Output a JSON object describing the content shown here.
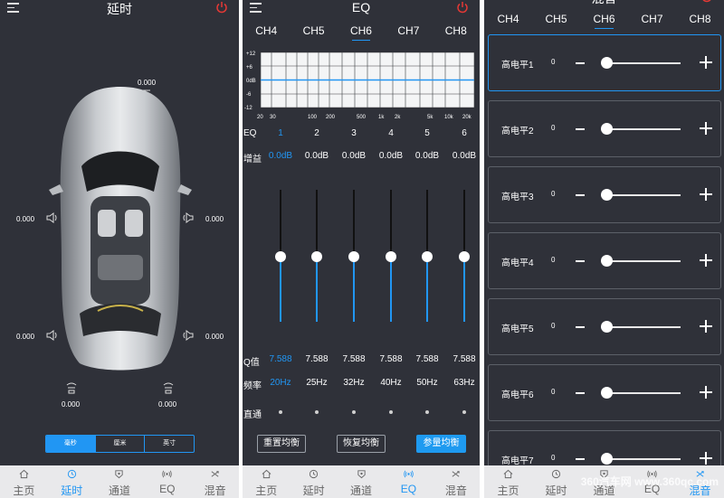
{
  "colors": {
    "accent": "#2196f3",
    "panel_bg": "#2f3139",
    "power": "#e53935",
    "nav_bg": "#e9e9eb"
  },
  "nav": [
    {
      "icon": "home-icon",
      "label": "主页"
    },
    {
      "icon": "clock-icon",
      "label": "延时"
    },
    {
      "icon": "channel-icon",
      "label": "通道"
    },
    {
      "icon": "eq-icon",
      "label": "EQ"
    },
    {
      "icon": "mix-icon",
      "label": "混音"
    }
  ],
  "panel1": {
    "title": "延时",
    "values": {
      "top": "0.000",
      "front_left": "0.000",
      "front_right": "0.000",
      "rear_left": "0.000",
      "rear_right": "0.000",
      "sub_left": "0.000",
      "sub_right": "0.000"
    },
    "units": [
      "毫秒",
      "厘米",
      "英寸"
    ],
    "active_unit": "毫秒",
    "active_nav": "延时"
  },
  "panel2": {
    "title": "EQ",
    "channels": [
      "CH4",
      "CH5",
      "CH6",
      "CH7",
      "CH8"
    ],
    "active_channel": "CH6",
    "graph": {
      "y_ticks": [
        "+12",
        "+6",
        "0dB",
        "-6",
        "-12"
      ],
      "x_ticks": [
        "20",
        "30",
        "100",
        "200",
        "500",
        "1k",
        "2k",
        "5k",
        "10k",
        "20k"
      ]
    },
    "eq_label": "EQ",
    "gain_label": "增益",
    "q_label": "Q值",
    "freq_label": "频率",
    "bypass_label": "直通",
    "bands": [
      {
        "n": "1",
        "gain": "0.0dB",
        "q": "7.588",
        "freq": "20Hz",
        "level": 0.5
      },
      {
        "n": "2",
        "gain": "0.0dB",
        "q": "7.588",
        "freq": "25Hz",
        "level": 0.5
      },
      {
        "n": "3",
        "gain": "0.0dB",
        "q": "7.588",
        "freq": "32Hz",
        "level": 0.5
      },
      {
        "n": "4",
        "gain": "0.0dB",
        "q": "7.588",
        "freq": "40Hz",
        "level": 0.5
      },
      {
        "n": "5",
        "gain": "0.0dB",
        "q": "7.588",
        "freq": "50Hz",
        "level": 0.5
      },
      {
        "n": "6",
        "gain": "0.0dB",
        "q": "7.588",
        "freq": "63Hz",
        "level": 0.5
      }
    ],
    "buttons": {
      "reset": "重置均衡",
      "restore": "恢复均衡",
      "param": "参量均衡"
    },
    "active_nav": "EQ"
  },
  "panel3": {
    "title": "混音",
    "channels": [
      "CH4",
      "CH5",
      "CH6",
      "CH7",
      "CH8"
    ],
    "active_channel": "CH6",
    "rows": [
      {
        "name": "高电平1",
        "value": "0"
      },
      {
        "name": "高电平2",
        "value": "0"
      },
      {
        "name": "高电平3",
        "value": "0"
      },
      {
        "name": "高电平4",
        "value": "0"
      },
      {
        "name": "高电平5",
        "value": "0"
      },
      {
        "name": "高电平6",
        "value": "0"
      },
      {
        "name": "高电平7",
        "value": "0"
      }
    ],
    "active_nav": "混音",
    "watermark": "360汽车网 www.360qc.com"
  }
}
